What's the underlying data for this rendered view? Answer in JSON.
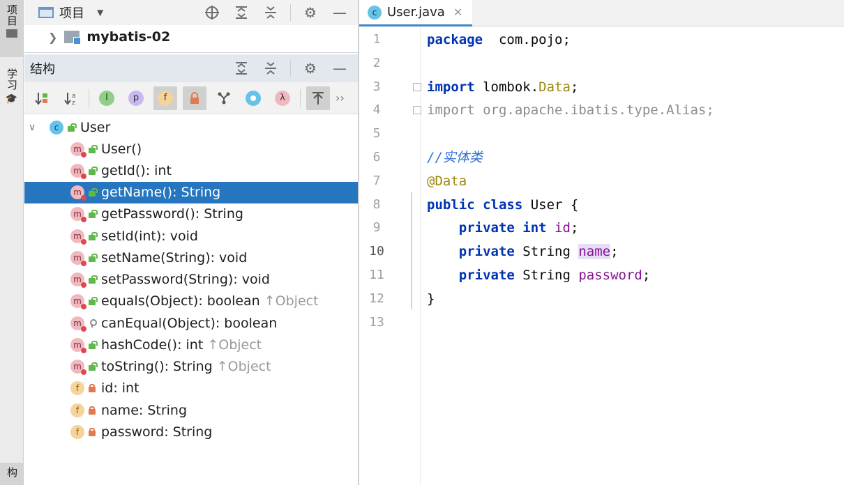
{
  "left_strip": {
    "project_tab": "项目",
    "learn_tab": "学习",
    "structure_tab": "构"
  },
  "project_panel": {
    "title": "项目",
    "module": "mybatis-02",
    "icons": [
      "locate-icon",
      "expand-all-icon",
      "collapse-all-icon",
      "settings-icon",
      "minimize-icon"
    ]
  },
  "structure_panel": {
    "title": "结构",
    "toolbar": [
      {
        "name": "sort-by-visibility-icon",
        "glyph": "↓≡"
      },
      {
        "name": "sort-alphabetically-icon",
        "glyph": "↓a"
      },
      {
        "name": "show-inherited-icon",
        "glyph": "I"
      },
      {
        "name": "show-properties-icon",
        "glyph": "p"
      },
      {
        "name": "show-fields-icon",
        "glyph": "f"
      },
      {
        "name": "show-non-public-icon",
        "glyph": "🔒"
      },
      {
        "name": "show-lombok-icon",
        "glyph": "⑂"
      },
      {
        "name": "anonymous-classes-icon",
        "glyph": "○"
      },
      {
        "name": "lambdas-icon",
        "glyph": "λ"
      },
      {
        "name": "autoscroll-from-source-icon",
        "glyph": "⇱"
      }
    ],
    "more": "››",
    "root": "User",
    "members": [
      {
        "kind": "m",
        "vis": "pub",
        "label": "User()",
        "inherit": ""
      },
      {
        "kind": "m",
        "vis": "pub",
        "label": "getId(): int",
        "inherit": ""
      },
      {
        "kind": "m",
        "vis": "pub",
        "label": "getName(): String",
        "inherit": "",
        "selected": true
      },
      {
        "kind": "m",
        "vis": "pub",
        "label": "getPassword(): String",
        "inherit": ""
      },
      {
        "kind": "m",
        "vis": "pub",
        "label": "setId(int): void",
        "inherit": ""
      },
      {
        "kind": "m",
        "vis": "pub",
        "label": "setName(String): void",
        "inherit": ""
      },
      {
        "kind": "m",
        "vis": "pub",
        "label": "setPassword(String): void",
        "inherit": ""
      },
      {
        "kind": "m",
        "vis": "pub",
        "label": "equals(Object): boolean",
        "inherit": "↑Object"
      },
      {
        "kind": "m",
        "vis": "prot",
        "label": "canEqual(Object): boolean",
        "inherit": ""
      },
      {
        "kind": "m",
        "vis": "pub",
        "label": "hashCode(): int",
        "inherit": "↑Object"
      },
      {
        "kind": "m",
        "vis": "pub",
        "label": "toString(): String",
        "inherit": "↑Object"
      },
      {
        "kind": "f",
        "vis": "priv",
        "label": "id: int",
        "inherit": ""
      },
      {
        "kind": "f",
        "vis": "priv",
        "label": "name: String",
        "inherit": ""
      },
      {
        "kind": "f",
        "vis": "priv",
        "label": "password: String",
        "inherit": ""
      }
    ]
  },
  "editor": {
    "tab_label": "User.java",
    "current_line": 10,
    "lines": [
      {
        "n": "1",
        "tokens": [
          [
            "kw",
            "package"
          ],
          [
            "",
            "  com.pojo;"
          ]
        ]
      },
      {
        "n": "2",
        "tokens": []
      },
      {
        "n": "3",
        "tokens": [
          [
            "kw",
            "import"
          ],
          [
            "",
            " lombok."
          ],
          [
            "ann",
            "Data"
          ],
          [
            "",
            ";"
          ]
        ]
      },
      {
        "n": "4",
        "tokens": [
          [
            "dim",
            "import org.apache.ibatis.type.Alias;"
          ]
        ]
      },
      {
        "n": "5",
        "tokens": []
      },
      {
        "n": "6",
        "tokens": [
          [
            "cmt",
            "//实体类"
          ]
        ]
      },
      {
        "n": "7",
        "tokens": [
          [
            "ann",
            "@Data"
          ]
        ]
      },
      {
        "n": "8",
        "tokens": [
          [
            "kw",
            "public class"
          ],
          [
            "",
            " User {"
          ]
        ]
      },
      {
        "n": "9",
        "tokens": [
          [
            "",
            "    "
          ],
          [
            "kw",
            "private int"
          ],
          [
            "",
            " "
          ],
          [
            "fld",
            "id"
          ],
          [
            "",
            ";"
          ]
        ]
      },
      {
        "n": "10",
        "tokens": [
          [
            "",
            "    "
          ],
          [
            "kw",
            "private"
          ],
          [
            "",
            " String "
          ],
          [
            "fld-sel",
            "name"
          ],
          [
            "",
            ";"
          ]
        ]
      },
      {
        "n": "11",
        "tokens": [
          [
            "",
            "    "
          ],
          [
            "kw",
            "private"
          ],
          [
            "",
            " String "
          ],
          [
            "fld",
            "password"
          ],
          [
            "",
            ";"
          ]
        ]
      },
      {
        "n": "12",
        "tokens": [
          [
            "",
            "}"
          ]
        ]
      },
      {
        "n": "13",
        "tokens": []
      }
    ]
  }
}
